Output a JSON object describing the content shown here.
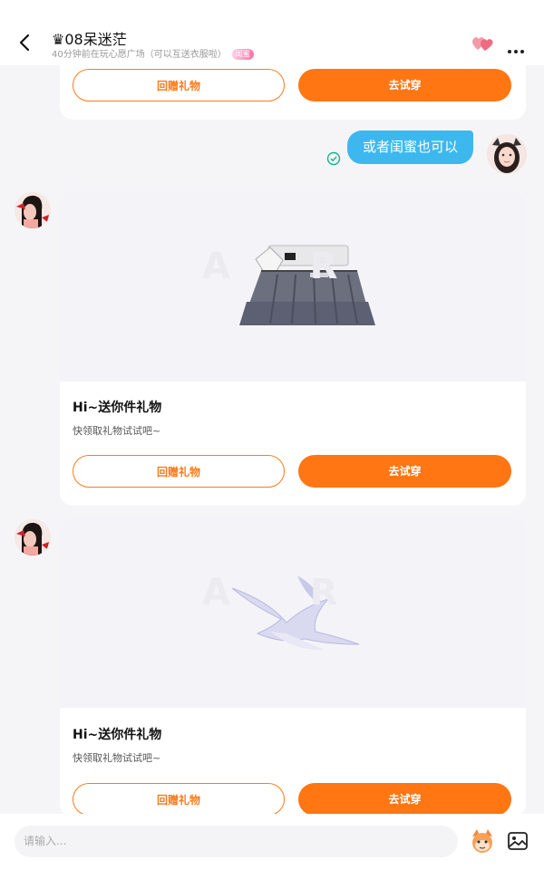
{
  "header": {
    "title": "♛08呆迷茫",
    "subtitle": "40分钟前在玩心愿广场（可以互送衣服啦）",
    "badge": "闺蜜"
  },
  "messages": {
    "top_card": {
      "return_gift": "回赠礼物",
      "try_on": "去试穿"
    },
    "my_message": "或者闺蜜也可以",
    "gift_cards": [
      {
        "title": "Hi~送你件礼物",
        "desc": "快领取礼物试试吧~",
        "return_gift": "回赠礼物",
        "try_on": "去试穿",
        "image": "skirt"
      },
      {
        "title": "Hi~送你件礼物",
        "desc": "快领取礼物试试吧~",
        "return_gift": "回赠礼物",
        "try_on": "去试穿",
        "image": "bird"
      }
    ]
  },
  "input": {
    "placeholder": "请输入..."
  },
  "icons": [
    "back-icon",
    "heart-icon",
    "more-icon",
    "check-icon",
    "emoji-icon",
    "image-icon"
  ]
}
